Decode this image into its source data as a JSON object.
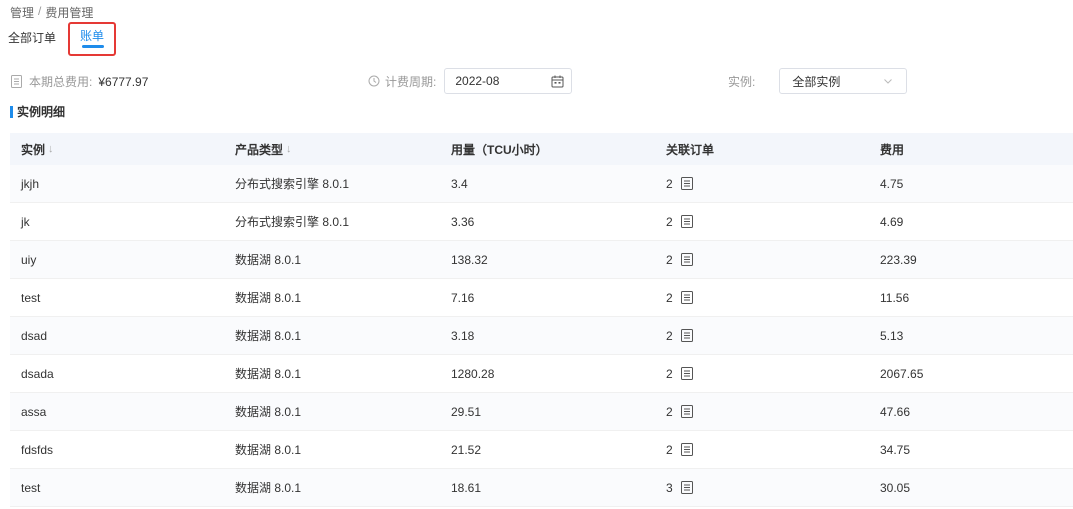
{
  "breadcrumb": {
    "root": "管理",
    "separator": "/",
    "current": "费用管理"
  },
  "tabs": [
    {
      "label": "全部订单"
    },
    {
      "label": "账单"
    }
  ],
  "filters": {
    "total_label": "本期总费用:",
    "total_value": "¥6777.97",
    "period_label": "计费周期:",
    "period_value": "2022-08",
    "instance_label": "实例:",
    "instance_value": "全部实例"
  },
  "section_title": "实例明细",
  "table": {
    "headers": [
      "实例",
      "产品类型",
      "用量（TCU小时）",
      "关联订单",
      "费用"
    ],
    "sort_glyph": "↓",
    "rows": [
      [
        "jkjh",
        "分布式搜索引擎 8.0.1",
        "3.4",
        "2",
        "4.75"
      ],
      [
        "jk",
        "分布式搜索引擎 8.0.1",
        "3.36",
        "2",
        "4.69"
      ],
      [
        "uiy",
        "数据湖 8.0.1",
        "138.32",
        "2",
        "223.39"
      ],
      [
        "test",
        "数据湖 8.0.1",
        "7.16",
        "2",
        "11.56"
      ],
      [
        "dsad",
        "数据湖 8.0.1",
        "3.18",
        "2",
        "5.13"
      ],
      [
        "dsada",
        "数据湖 8.0.1",
        "1280.28",
        "2",
        "2067.65"
      ],
      [
        "assa",
        "数据湖 8.0.1",
        "29.51",
        "2",
        "47.66"
      ],
      [
        "fdsfds",
        "数据湖 8.0.1",
        "21.52",
        "2",
        "34.75"
      ],
      [
        "test",
        "数据湖 8.0.1",
        "18.61",
        "3",
        "30.05"
      ]
    ]
  },
  "colors": {
    "accent": "#1e8ceb",
    "highlight_border": "#e53935",
    "header_bg": "#f3f6fb"
  }
}
